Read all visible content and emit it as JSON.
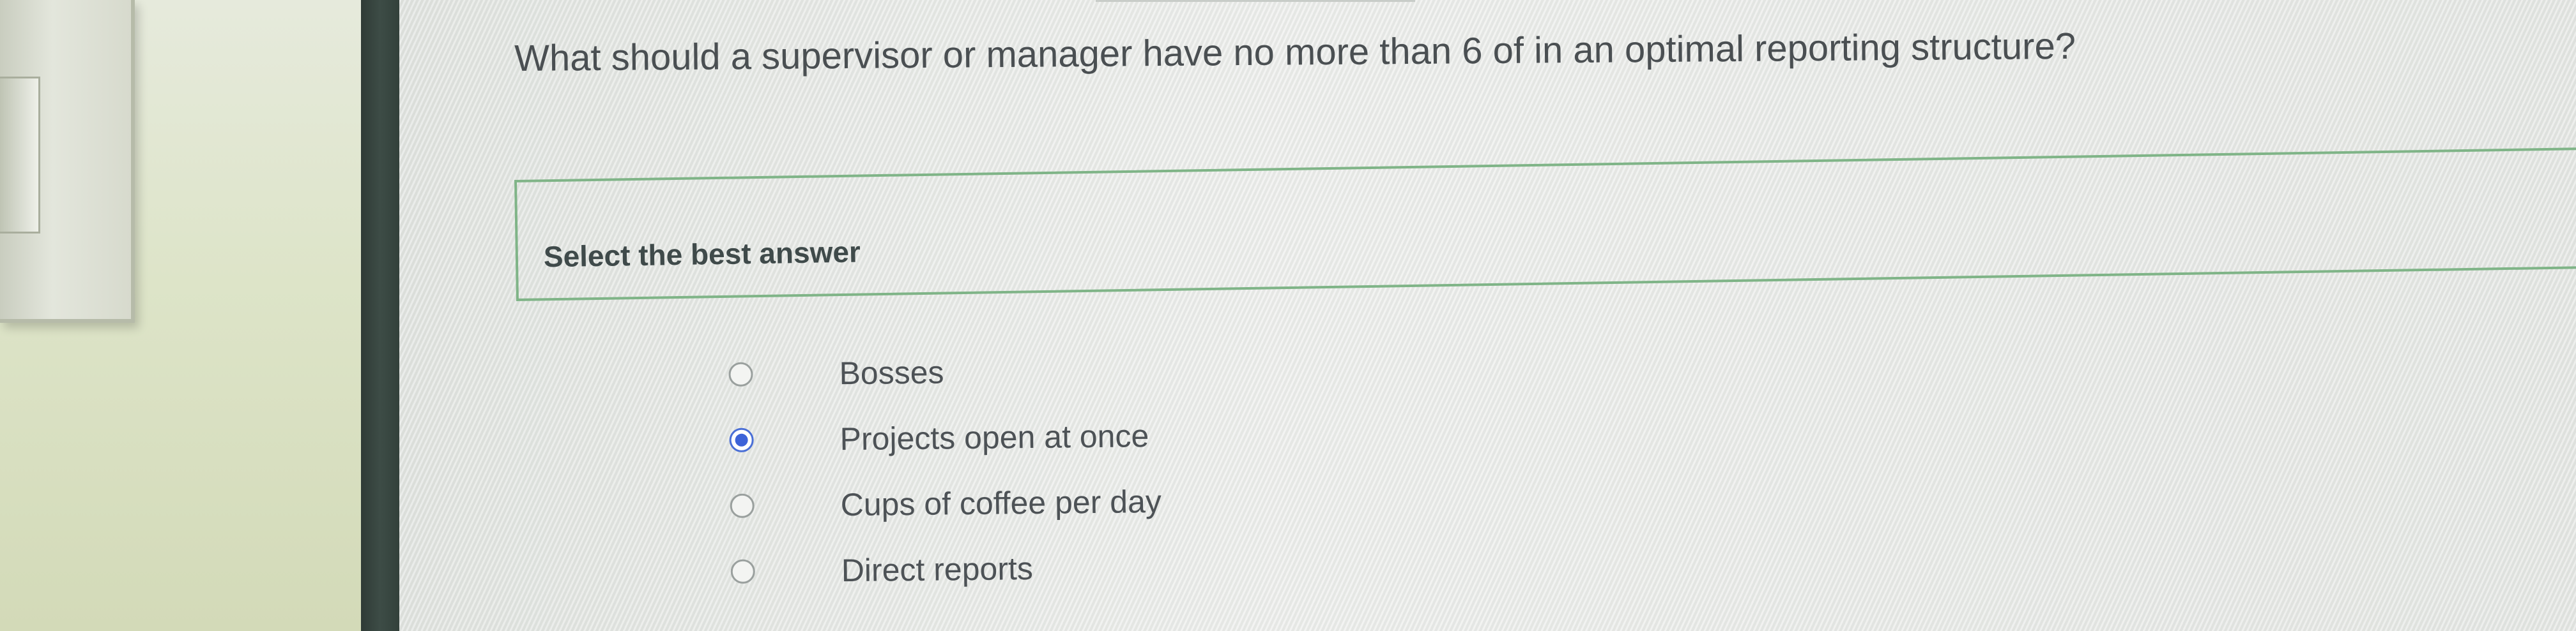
{
  "question": {
    "text": "What should a supervisor or manager have no more than 6 of in an optimal reporting structure?"
  },
  "answer_section": {
    "header": "Select the best answer"
  },
  "options": [
    {
      "label": "Bosses",
      "selected": false
    },
    {
      "label": "Projects open at once",
      "selected": true
    },
    {
      "label": "Cups of coffee per day",
      "selected": false
    },
    {
      "label": "Direct reports",
      "selected": false
    }
  ],
  "colors": {
    "accent_border": "#7fb487",
    "radio_selected": "#3d63d8",
    "text": "#4a4f52"
  }
}
